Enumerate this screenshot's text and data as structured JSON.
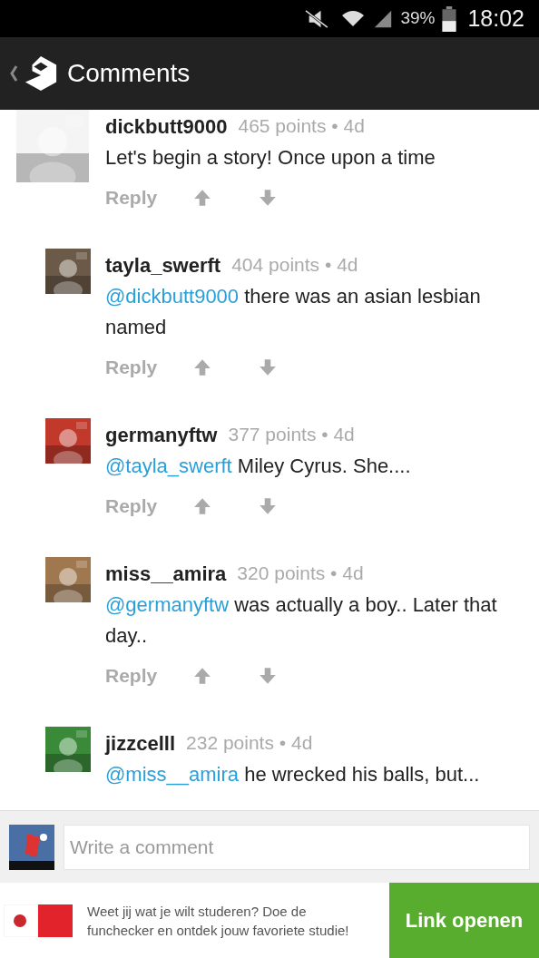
{
  "status_bar": {
    "battery": "39%",
    "time": "18:02"
  },
  "header": {
    "title": "Comments"
  },
  "comments": [
    {
      "username": "dickbutt9000",
      "points": "465 points",
      "age": "• 4d",
      "text": "Let's begin a story! Once upon a time",
      "reply_label": "Reply",
      "children": [
        {
          "username": "tayla_swerft",
          "points": "404 points",
          "age": "• 4d",
          "mention": "@dickbutt9000",
          "text": "there was an asian lesbian named",
          "reply_label": "Reply"
        },
        {
          "username": "germanyftw",
          "points": "377 points",
          "age": "• 4d",
          "mention": "@tayla_swerft",
          "text": "Miley Cyrus. She....",
          "reply_label": "Reply"
        },
        {
          "username": "miss__amira",
          "points": "320 points",
          "age": "• 4d",
          "mention": "@germanyftw",
          "text": "was actually a boy.. Later that day..",
          "reply_label": "Reply"
        },
        {
          "username": "jizzcelll",
          "points": "232 points",
          "age": "• 4d",
          "mention": "@miss__amira",
          "text": "he wrecked his balls, but..."
        }
      ]
    }
  ],
  "composer": {
    "placeholder": "Write a comment"
  },
  "ad": {
    "text": "Weet jij wat je wilt studeren? Doe de funchecker en ontdek jouw favoriete studie!",
    "button": "Link openen"
  }
}
